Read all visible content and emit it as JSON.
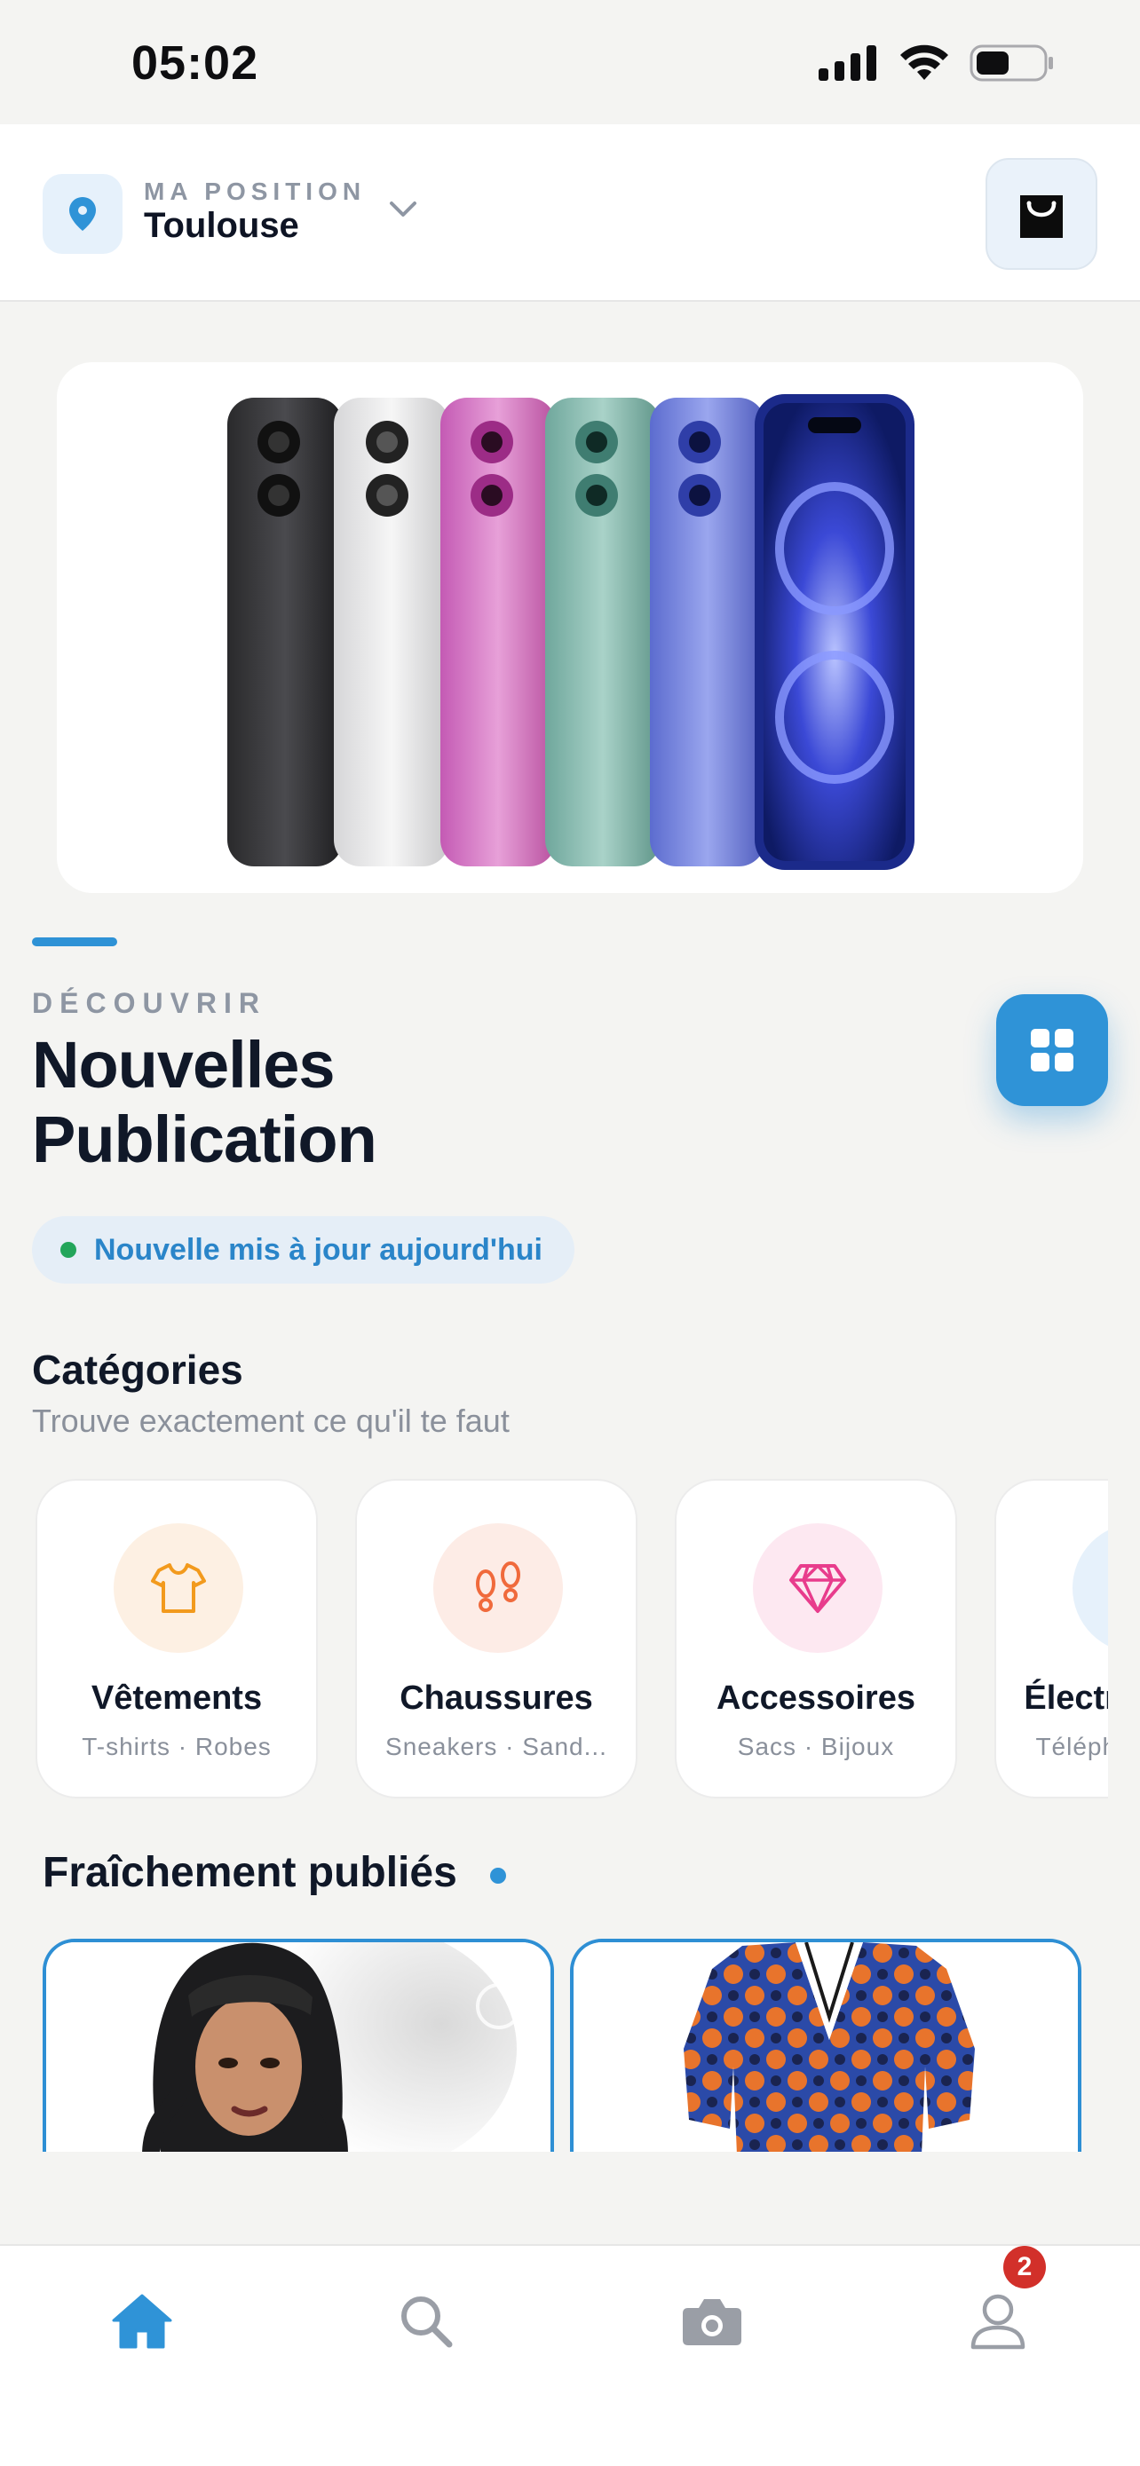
{
  "status_bar": {
    "time": "05:02"
  },
  "header": {
    "position_label": "MA POSITION",
    "city": "Toulouse",
    "icons": {
      "location": "map-pin-icon",
      "dropdown": "chevron-down-icon",
      "cart": "shopping-bag-icon"
    }
  },
  "banner": {
    "image": "smartphone-lineup-banner"
  },
  "discover": {
    "eyebrow": "DÉCOUVRIR",
    "title_line1": "Nouvelles",
    "title_line2": "Publication",
    "update_text": "Nouvelle mis à jour aujourd'hui"
  },
  "categories": {
    "title": "Catégories",
    "subtitle": "Trouve exactement ce qu'il te faut",
    "items": [
      {
        "name": "Vêtements",
        "tags": "T-shirts · Robes",
        "icon": "tshirt-icon",
        "color": "#f29a1d",
        "bg": "#fdf0e3"
      },
      {
        "name": "Chaussures",
        "tags": "Sneakers · Sand...",
        "icon": "footprints-icon",
        "color": "#f06a3c",
        "bg": "#fdece6"
      },
      {
        "name": "Accessoires",
        "tags": "Sacs · Bijoux",
        "icon": "diamond-icon",
        "color": "#e83c8c",
        "bg": "#fde8f1"
      },
      {
        "name": "Électroniques",
        "tags": "Téléphones · PC",
        "icon": "phone-icon",
        "color": "#2f93d7",
        "bg": "#e6f1fb"
      }
    ]
  },
  "fresh": {
    "title": "Fraîchement publiés",
    "products": [
      {
        "image": "woman-curly-hair-portrait"
      },
      {
        "image": "african-print-dress"
      }
    ]
  },
  "tabbar": {
    "tabs": [
      {
        "icon": "home-icon",
        "active": true
      },
      {
        "icon": "search-icon",
        "active": false
      },
      {
        "icon": "camera-icon",
        "active": false
      },
      {
        "icon": "profile-icon",
        "active": false
      }
    ],
    "profile_badge": "2"
  },
  "colors": {
    "accent": "#2f93d7",
    "text": "#101828",
    "muted": "#8a909b"
  }
}
